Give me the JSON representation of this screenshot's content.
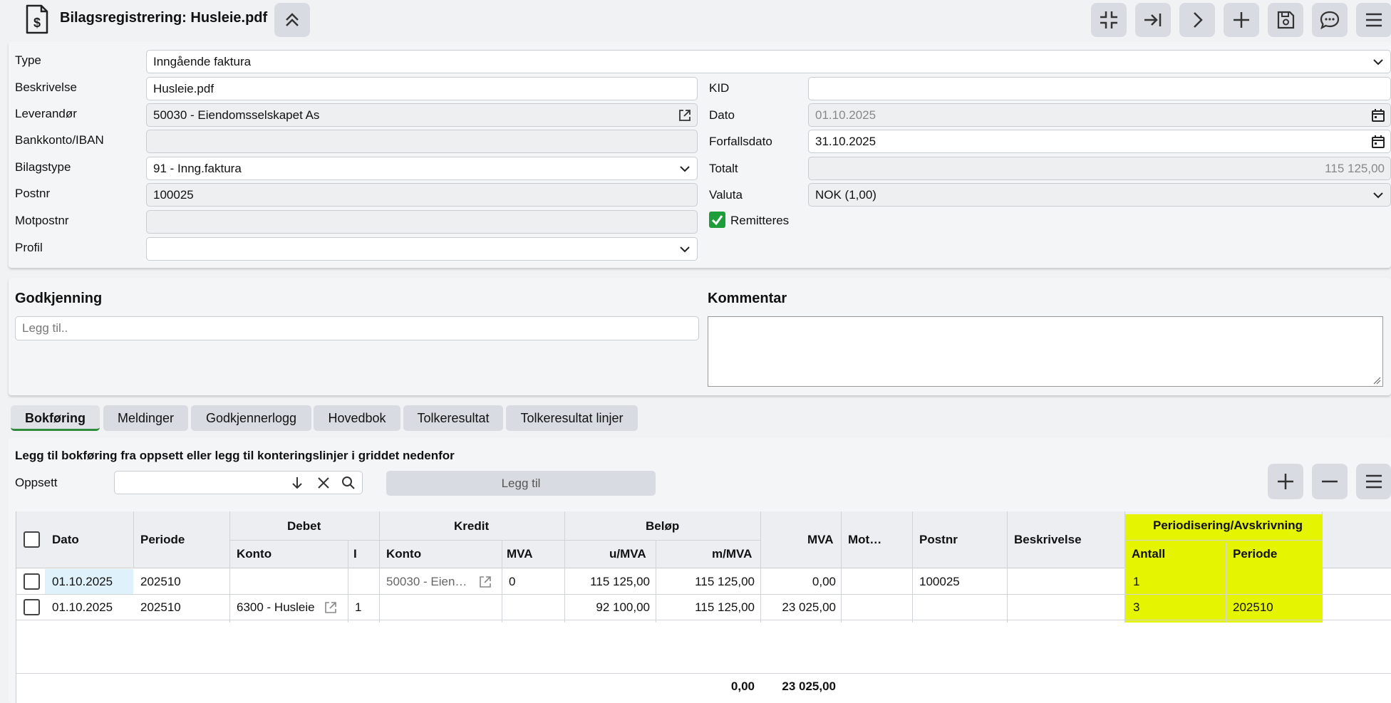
{
  "header": {
    "title": "Bilagsregistrering: Husleie.pdf"
  },
  "form": {
    "type_label": "Type",
    "type_value": "Inngående faktura",
    "beskrivelse_label": "Beskrivelse",
    "beskrivelse_value": "Husleie.pdf",
    "leverandor_label": "Leverandør",
    "leverandor_value": "50030 - Eiendomsselskapet As",
    "bankkonto_label": "Bankkonto/IBAN",
    "bankkonto_value": "",
    "bilagstype_label": "Bilagstype",
    "bilagstype_value": "91 - Inng.faktura",
    "postnr_label": "Postnr",
    "postnr_value": "100025",
    "motpostnr_label": "Motpostnr",
    "motpostnr_value": "",
    "profil_label": "Profil",
    "profil_value": "",
    "kid_label": "KID",
    "kid_value": "",
    "dato_label": "Dato",
    "dato_value": "01.10.2025",
    "forfallsdato_label": "Forfallsdato",
    "forfallsdato_value": "31.10.2025",
    "totalt_label": "Totalt",
    "totalt_value": "115 125,00",
    "valuta_label": "Valuta",
    "valuta_value": "NOK (1,00)",
    "remitteres_label": "Remitteres",
    "remitteres_checked": true
  },
  "approval": {
    "godkjenning_title": "Godkjenning",
    "godkjenning_placeholder": "Legg til..",
    "kommentar_title": "Kommentar"
  },
  "tabs": [
    {
      "label": "Bokføring",
      "active": true
    },
    {
      "label": "Meldinger"
    },
    {
      "label": "Godkjennerlogg"
    },
    {
      "label": "Hovedbok"
    },
    {
      "label": "Tolkeresultat"
    },
    {
      "label": "Tolkeresultat linjer"
    }
  ],
  "bokforing": {
    "instruction": "Legg til bokføring fra oppsett eller legg til konteringslinjer i griddet nedenfor",
    "oppsett_label": "Oppsett",
    "oppsett_value": "",
    "legg_til_label": "Legg til"
  },
  "grid": {
    "headers": {
      "dato": "Dato",
      "periode": "Periode",
      "debet": "Debet",
      "kredit": "Kredit",
      "belop": "Beløp",
      "debet_konto": "Konto",
      "debet_i": "I",
      "kredit_konto": "Konto",
      "kredit_mva": "MVA",
      "u_mva": "u/MVA",
      "m_mva": "m/MVA",
      "mva": "MVA",
      "mot": "Mot…",
      "postnr": "Postnr",
      "beskrivelse": "Beskrivelse",
      "periodisering": "Periodisering/Avskrivning",
      "antall": "Antall",
      "per_periode": "Periode"
    },
    "rows": [
      {
        "dato": "01.10.2025",
        "periode": "202510",
        "debet_konto": "",
        "debet_i": "",
        "kredit_konto": "50030 - Eien…",
        "kredit_mva": "0",
        "u_mva": "115 125,00",
        "m_mva": "115 125,00",
        "mva": "0,00",
        "mot": "",
        "postnr": "100025",
        "beskrivelse": "",
        "antall": "1",
        "per_periode": ""
      },
      {
        "dato": "01.10.2025",
        "periode": "202510",
        "debet_konto": "6300 - Husleie",
        "debet_i": "1",
        "kredit_konto": "",
        "kredit_mva": "",
        "u_mva": "92 100,00",
        "m_mva": "115 125,00",
        "mva": "23 025,00",
        "mot": "",
        "postnr": "",
        "beskrivelse": "",
        "antall": "3",
        "per_periode": "202510"
      }
    ],
    "totals": {
      "m_mva": "0,00",
      "mva": "23 025,00"
    }
  },
  "colors": {
    "highlight": "#e5f501",
    "accent_green": "#2e8b3a"
  }
}
